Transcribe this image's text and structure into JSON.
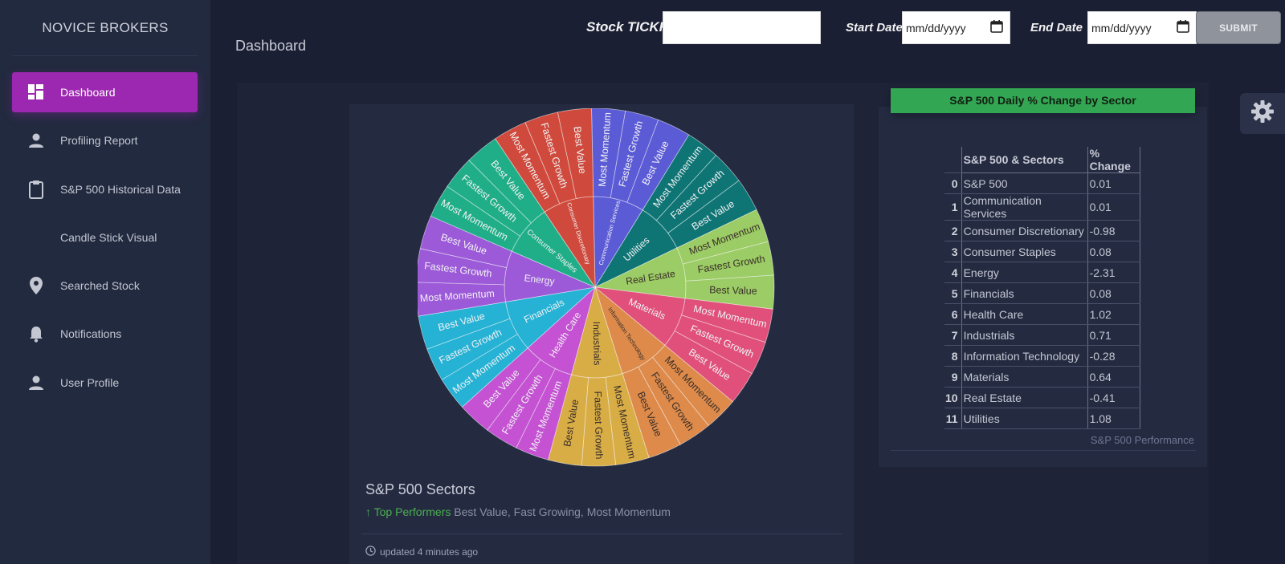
{
  "brand": "NOVICE BROKERS",
  "colors": {
    "accent": "#9c27b0",
    "table_header": "#33a654",
    "positive": "#4caf50"
  },
  "sidebar": {
    "items": [
      {
        "label": "Dashboard",
        "icon": "dashboard-icon",
        "active": true
      },
      {
        "label": "Profiling Report",
        "icon": "person-icon"
      },
      {
        "label": "S&P 500 Historical Data",
        "icon": "clipboard-icon"
      },
      {
        "label": "Candle Stick Visual",
        "icon": ""
      },
      {
        "label": "Searched Stock",
        "icon": "location-pin-icon"
      },
      {
        "label": "Notifications",
        "icon": "bell-icon"
      },
      {
        "label": "User Profile",
        "icon": "person-icon"
      }
    ]
  },
  "header": {
    "page_title": "Dashboard",
    "tickr_label": "Stock TICKR",
    "tickr_value": "",
    "start_label": "Start Date",
    "start_placeholder": "mm/dd/yyyy",
    "end_label": "End Date",
    "end_placeholder": "mm/dd/yyyy",
    "submit_label": "SUBMIT"
  },
  "table_card": {
    "title": "S&P 500 Daily % Change by Sector",
    "columns": [
      "",
      "S&P 500 & Sectors",
      "% Change"
    ],
    "rows": [
      {
        "idx": "0",
        "sector": "S&P 500",
        "change": "0.01"
      },
      {
        "idx": "1",
        "sector": "Communication Services",
        "change": "0.01"
      },
      {
        "idx": "2",
        "sector": "Consumer Discretionary",
        "change": "-0.98"
      },
      {
        "idx": "3",
        "sector": "Consumer Staples",
        "change": "0.08"
      },
      {
        "idx": "4",
        "sector": "Energy",
        "change": "-2.31"
      },
      {
        "idx": "5",
        "sector": "Financials",
        "change": "0.08"
      },
      {
        "idx": "6",
        "sector": "Health Care",
        "change": "1.02"
      },
      {
        "idx": "7",
        "sector": "Industrials",
        "change": "0.71"
      },
      {
        "idx": "8",
        "sector": "Information Technology",
        "change": "-0.28"
      },
      {
        "idx": "9",
        "sector": "Materials",
        "change": "0.64"
      },
      {
        "idx": "10",
        "sector": "Real Estate",
        "change": "-0.41"
      },
      {
        "idx": "11",
        "sector": "Utilities",
        "change": "1.08"
      }
    ],
    "footer": "S&P 500 Performance"
  },
  "chart_card": {
    "title": "S&P 500 Sectors",
    "sub_highlight": "Top Performers",
    "sub_text": "Best Value, Fast Growing, Most Momentum",
    "updated": "updated 4 minutes ago"
  },
  "chart_data": {
    "type": "sunburst",
    "sectors": [
      {
        "name": "Communication Services",
        "color": "#5b5bd6",
        "children": [
          "Most Momentum",
          "Fastest Growth",
          "Best Value"
        ]
      },
      {
        "name": "Utilities",
        "color": "#0e7474",
        "children": [
          "Most Momentum",
          "Fastest Growth",
          "Best Value"
        ]
      },
      {
        "name": "Real Estate",
        "color": "#9ccc65",
        "children": [
          "Most Momentum",
          "Fastest Growth",
          "Best Value"
        ]
      },
      {
        "name": "Materials",
        "color": "#e0507a",
        "children": [
          "Most Momentum",
          "Fastest Growth",
          "Best Value"
        ]
      },
      {
        "name": "Information Technology",
        "color": "#dd8a4a",
        "children": [
          "Most Momentum",
          "Fastest Growth",
          "Best Value"
        ]
      },
      {
        "name": "Industrials",
        "color": "#d9ad45",
        "children": [
          "Most Momentum",
          "Fastest Growth",
          "Best Value"
        ]
      },
      {
        "name": "Health Care",
        "color": "#c452d2",
        "children": [
          "Most Momentum",
          "Fastest Growth",
          "Best Value"
        ]
      },
      {
        "name": "Financials",
        "color": "#25b2d4",
        "children": [
          "Most Momentum",
          "Fastest Growth",
          "Best Value"
        ]
      },
      {
        "name": "Energy",
        "color": "#9c5ad8",
        "children": [
          "Most Momentum",
          "Fastest Growth",
          "Best Value"
        ]
      },
      {
        "name": "Consumer Staples",
        "color": "#1fae87",
        "children": [
          "Most Momentum",
          "Fastest Growth",
          "Best Value"
        ]
      },
      {
        "name": "Consumer Discretionary",
        "color": "#cf4a3c",
        "children": [
          "Most Momentum",
          "Fastest Growth",
          "Best Value"
        ]
      }
    ]
  }
}
